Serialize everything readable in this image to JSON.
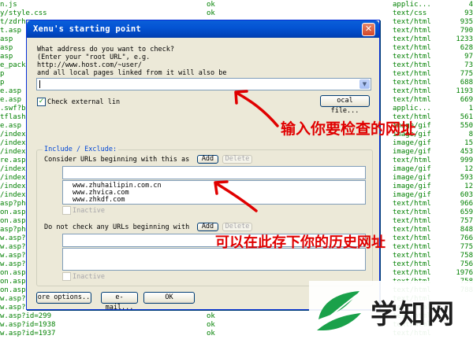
{
  "background_rows": [
    {
      "url": "n.js",
      "status": "ok",
      "type": "applic...",
      "size": "4"
    },
    {
      "url": "y/style.css",
      "status": "ok",
      "type": "text/css",
      "size": "93"
    },
    {
      "url": "t/zdrhu",
      "status": "",
      "type": "text/html",
      "size": "935"
    },
    {
      "url": "t.asp",
      "status": "",
      "type": "text/html",
      "size": "790"
    },
    {
      "url": "asp",
      "status": "",
      "type": "text/html",
      "size": "1233"
    },
    {
      "url": "asp",
      "status": "",
      "type": "text/html",
      "size": "628"
    },
    {
      "url": "asp",
      "status": "",
      "type": "text/html",
      "size": "97"
    },
    {
      "url": "e_packa",
      "status": "",
      "type": "text/html",
      "size": "73"
    },
    {
      "url": "p",
      "status": "",
      "type": "text/html",
      "size": "775"
    },
    {
      "url": "p",
      "status": "",
      "type": "text/html",
      "size": "688"
    },
    {
      "url": "e.asp",
      "status": "",
      "type": "text/html",
      "size": "1193"
    },
    {
      "url": "e.asp",
      "status": "",
      "type": "text/html",
      "size": "669"
    },
    {
      "url": ".swf?bc",
      "status": "",
      "type": "applic...",
      "size": "1"
    },
    {
      "url": "tflashp",
      "status": "",
      "type": "text/html",
      "size": "561"
    },
    {
      "url": "e.asp",
      "status": "",
      "type": "image/gif",
      "size": "550"
    },
    {
      "url": "/index-",
      "status": "",
      "type": "image/gif",
      "size": "8"
    },
    {
      "url": "/index-",
      "status": "",
      "type": "image/gif",
      "size": "15"
    },
    {
      "url": "/index-",
      "status": "",
      "type": "image/gif",
      "size": "453"
    },
    {
      "url": "re.asp",
      "status": "",
      "type": "text/html",
      "size": "999"
    },
    {
      "url": "/index-",
      "status": "",
      "type": "image/gif",
      "size": "12"
    },
    {
      "url": "/index-",
      "status": "",
      "type": "image/gif",
      "size": "593"
    },
    {
      "url": "/index-",
      "status": "",
      "type": "image/gif",
      "size": "12"
    },
    {
      "url": "/index-",
      "status": "",
      "type": "image/gif",
      "size": "603"
    },
    {
      "url": "asp?ph=1",
      "status": "",
      "type": "text/html",
      "size": "966"
    },
    {
      "url": "on.asp",
      "status": "",
      "type": "text/html",
      "size": "659"
    },
    {
      "url": "on.asp",
      "status": "",
      "type": "text/html",
      "size": "757"
    },
    {
      "url": "asp?ph=1",
      "status": "",
      "type": "text/html",
      "size": "848"
    },
    {
      "url": "w.asp?i",
      "status": "",
      "type": "text/html",
      "size": "766"
    },
    {
      "url": "w.asp?i",
      "status": "",
      "type": "text/html",
      "size": "775"
    },
    {
      "url": "w.asp?i",
      "status": "",
      "type": "text/html",
      "size": "758"
    },
    {
      "url": "w.asp?i",
      "status": "",
      "type": "text/html",
      "size": "756"
    },
    {
      "url": "on.asp?",
      "status": "",
      "type": "text/html",
      "size": "1976"
    },
    {
      "url": "on.asp?",
      "status": "",
      "type": "text/html",
      "size": "758"
    },
    {
      "url": "on.asp?",
      "status": "",
      "type": "text/html",
      "size": "788"
    },
    {
      "url": "w.asp?i",
      "status": "",
      "type": "text/html",
      "size": ""
    },
    {
      "url": "w.asp?i",
      "status": "",
      "type": "text/html",
      "size": ""
    },
    {
      "url": "w.asp?id=299",
      "status": "ok",
      "type": "text/html",
      "size": ""
    },
    {
      "url": "w.asp?id=1938",
      "status": "ok",
      "type": "text/html",
      "size": ""
    },
    {
      "url": "w.asp?id=1937",
      "status": "ok",
      "type": "text/html",
      "size": ""
    }
  ],
  "dialog": {
    "title": "Xenu's starting point",
    "close_glyph": "✕",
    "prompt": "What address do you want to check?\n(Enter your \"root URL\", e.g.\nhttp://www.host.com/~user/\nand all local pages linked from it will also be",
    "url_value": "",
    "check_external_label": "Check external lin",
    "check_external_checked": "✓",
    "local_file_button": "ocal file...",
    "group_label": "Include / Exclude:",
    "consider_label": "Consider URLs beginning with this as",
    "add_button": "Add",
    "delete_button": "Delete",
    "include_items": [
      "www.zhuhailipin.com.cn",
      "www.zhvica.com",
      "www.zhkdf.com"
    ],
    "inactive_label": "Inactive",
    "exclude_label": "Do not check any URLs beginning with",
    "add_button_2": "Add",
    "delete_button_2": "Delete",
    "inactive_label_2": "Inactive",
    "more_options_button": "ore options..",
    "email_button": "e-mail...",
    "ok_button": "OK"
  },
  "annotations": {
    "top": "输入你要检查的网址",
    "bottom": "可以在此存下你的历史网址",
    "color": "#e00000"
  },
  "logo": {
    "text": "学知网",
    "leaf_color": "#1aa14a"
  }
}
